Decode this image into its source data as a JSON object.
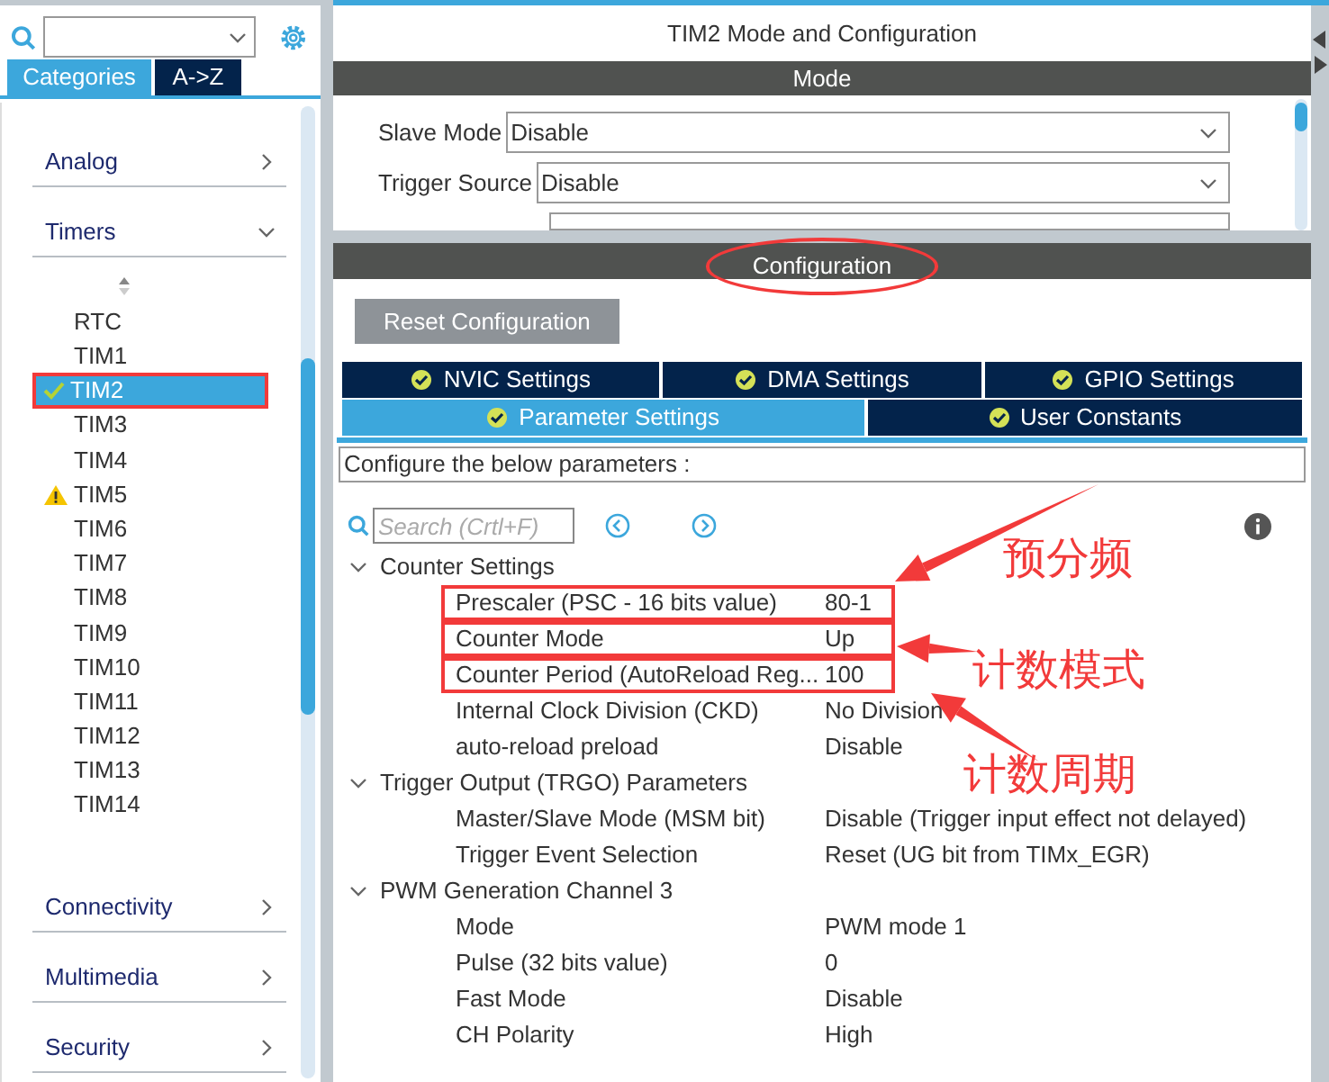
{
  "sidebar": {
    "tabs": [
      {
        "label": "Categories",
        "selected": true
      },
      {
        "label": "A->Z",
        "selected": false
      }
    ],
    "categories": [
      {
        "label": "Analog",
        "expanded": false
      },
      {
        "label": "Timers",
        "expanded": true,
        "children": [
          {
            "label": "RTC",
            "selected": false,
            "kind": "plain",
            "highlighted": false
          },
          {
            "label": "TIM1",
            "selected": false,
            "kind": "plain",
            "highlighted": false
          },
          {
            "label": "TIM2",
            "selected": true,
            "kind": "ok",
            "highlighted": true
          },
          {
            "label": "TIM3",
            "selected": false,
            "kind": "plain",
            "highlighted": false
          },
          {
            "label": "TIM4",
            "selected": false,
            "kind": "plain",
            "highlighted": false
          },
          {
            "label": "TIM5",
            "selected": false,
            "kind": "warning",
            "highlighted": false
          },
          {
            "label": "TIM6",
            "selected": false,
            "kind": "plain",
            "highlighted": false
          },
          {
            "label": "TIM7",
            "selected": false,
            "kind": "plain",
            "highlighted": false
          },
          {
            "label": "TIM8",
            "selected": false,
            "kind": "plain",
            "highlighted": false
          },
          {
            "label": "TIM9",
            "selected": false,
            "kind": "plain",
            "highlighted": false
          },
          {
            "label": "TIM10",
            "selected": false,
            "kind": "plain",
            "highlighted": false
          },
          {
            "label": "TIM11",
            "selected": false,
            "kind": "plain",
            "highlighted": false
          },
          {
            "label": "TIM12",
            "selected": false,
            "kind": "plain",
            "highlighted": false
          },
          {
            "label": "TIM13",
            "selected": false,
            "kind": "plain",
            "highlighted": false
          },
          {
            "label": "TIM14",
            "selected": false,
            "kind": "plain",
            "highlighted": false
          }
        ]
      },
      {
        "label": "Connectivity",
        "expanded": false
      },
      {
        "label": "Multimedia",
        "expanded": false
      },
      {
        "label": "Security",
        "expanded": false
      }
    ]
  },
  "panel": {
    "title": "TIM2 Mode and Configuration",
    "mode_header": "Mode",
    "mode_fields": [
      {
        "label": "Slave Mode",
        "value": "Disable"
      },
      {
        "label": "Trigger Source",
        "value": "Disable"
      }
    ],
    "config_header": {
      "label": "Configuration",
      "circled": true
    },
    "reset_button": "Reset Configuration",
    "config_tabs": [
      [
        {
          "label": "NVIC Settings",
          "selected": false
        },
        {
          "label": "DMA Settings",
          "selected": false
        },
        {
          "label": "GPIO Settings",
          "selected": false
        }
      ],
      [
        {
          "label": "Parameter Settings",
          "selected": true
        },
        {
          "label": "User Constants",
          "selected": false
        }
      ]
    ],
    "description": "Configure the below parameters :",
    "search": {
      "placeholder": "Search (Crtl+F)"
    },
    "groups": [
      {
        "label": "Counter Settings",
        "expanded": true,
        "params": [
          {
            "name": "Prescaler (PSC - 16 bits value)",
            "value": "80-1",
            "highlighted": true
          },
          {
            "name": "Counter Mode",
            "value": "Up",
            "highlighted": true
          },
          {
            "name": "Counter Period (AutoReload Reg...",
            "value": "100",
            "highlighted": true
          },
          {
            "name": "Internal Clock Division (CKD)",
            "value": "No Division",
            "highlighted": false
          },
          {
            "name": "auto-reload preload",
            "value": "Disable",
            "highlighted": false
          }
        ]
      },
      {
        "label": "Trigger Output (TRGO) Parameters",
        "expanded": true,
        "params": [
          {
            "name": "Master/Slave Mode (MSM bit)",
            "value": "Disable (Trigger input effect not delayed)",
            "highlighted": false
          },
          {
            "name": "Trigger Event Selection",
            "value": "Reset (UG bit from TIMx_EGR)",
            "highlighted": false
          }
        ]
      },
      {
        "label": "PWM Generation Channel 3",
        "expanded": true,
        "params": [
          {
            "name": "Mode",
            "value": "PWM mode 1",
            "highlighted": false
          },
          {
            "name": "Pulse (32 bits value)",
            "value": "0",
            "highlighted": false
          },
          {
            "name": "Fast Mode",
            "value": "Disable",
            "highlighted": false
          },
          {
            "name": "CH Polarity",
            "value": "High",
            "highlighted": false
          }
        ]
      }
    ]
  },
  "annotations": [
    {
      "text": "预分频"
    },
    {
      "text": "计数模式"
    },
    {
      "text": "计数周期"
    }
  ]
}
